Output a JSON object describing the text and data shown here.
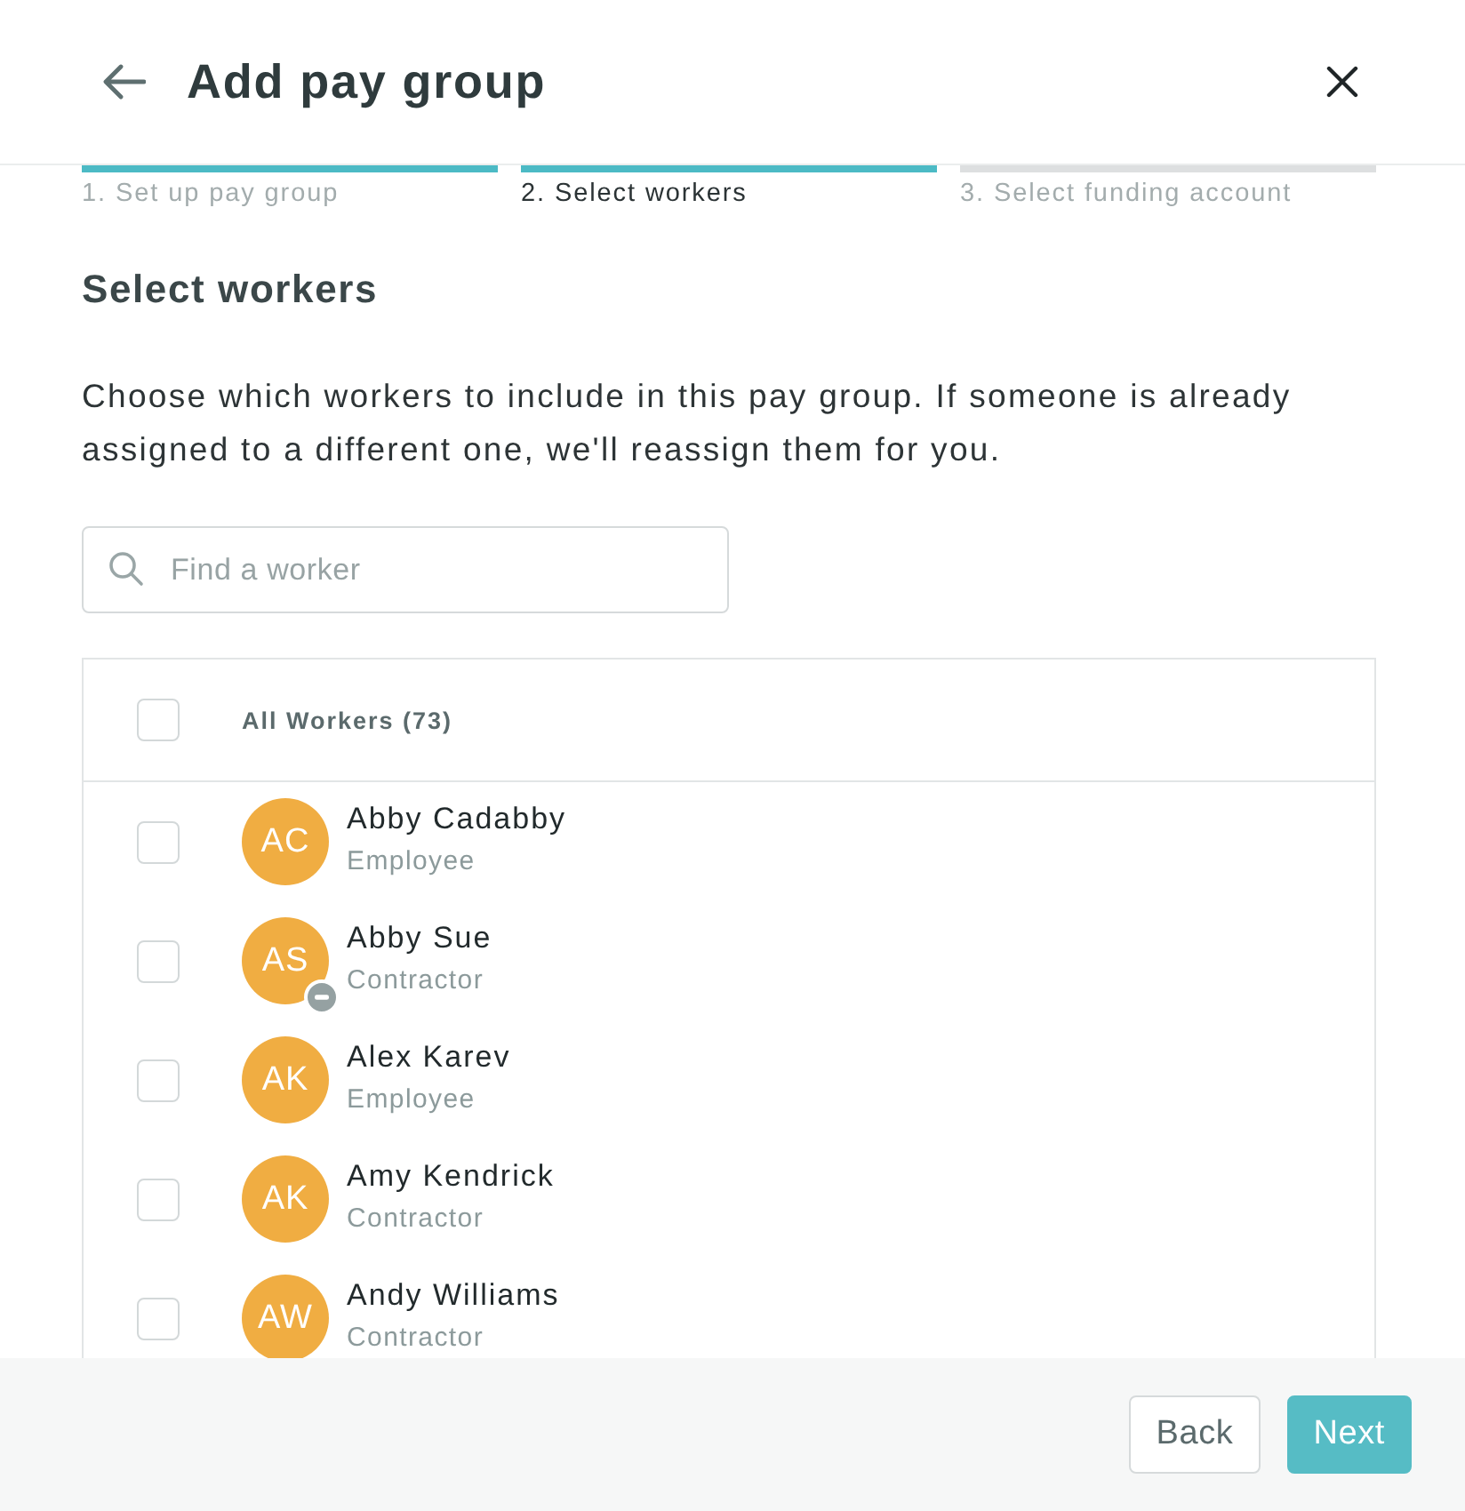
{
  "header": {
    "title": "Add pay group"
  },
  "steps": [
    {
      "label": "1. Set up pay group",
      "reached": true,
      "selected": false
    },
    {
      "label": "2. Select workers",
      "reached": true,
      "selected": true
    },
    {
      "label": "3. Select funding account",
      "reached": false,
      "selected": false
    }
  ],
  "section": {
    "heading": "Select workers",
    "description": "Choose which workers to include in this pay group. If someone is already assigned to a different one, we'll reassign them for you."
  },
  "search": {
    "placeholder": "Find a worker"
  },
  "workers_table": {
    "select_all": {
      "label": "All Workers (73)",
      "checked": false
    },
    "rows": [
      {
        "initials": "AC",
        "name": "Abby Cadabby",
        "role": "Employee",
        "checked": false,
        "minus_badge": false
      },
      {
        "initials": "AS",
        "name": "Abby Sue",
        "role": "Contractor",
        "checked": false,
        "minus_badge": true
      },
      {
        "initials": "AK",
        "name": "Alex Karev",
        "role": "Employee",
        "checked": false,
        "minus_badge": false
      },
      {
        "initials": "AK",
        "name": "Amy Kendrick",
        "role": "Contractor",
        "checked": false,
        "minus_badge": false
      },
      {
        "initials": "AW",
        "name": "Andy Williams",
        "role": "Contractor",
        "checked": false,
        "minus_badge": false
      }
    ]
  },
  "footer": {
    "buttons": [
      {
        "label": "Back",
        "kind": "secondary"
      },
      {
        "label": "Next",
        "kind": "primary"
      }
    ]
  }
}
